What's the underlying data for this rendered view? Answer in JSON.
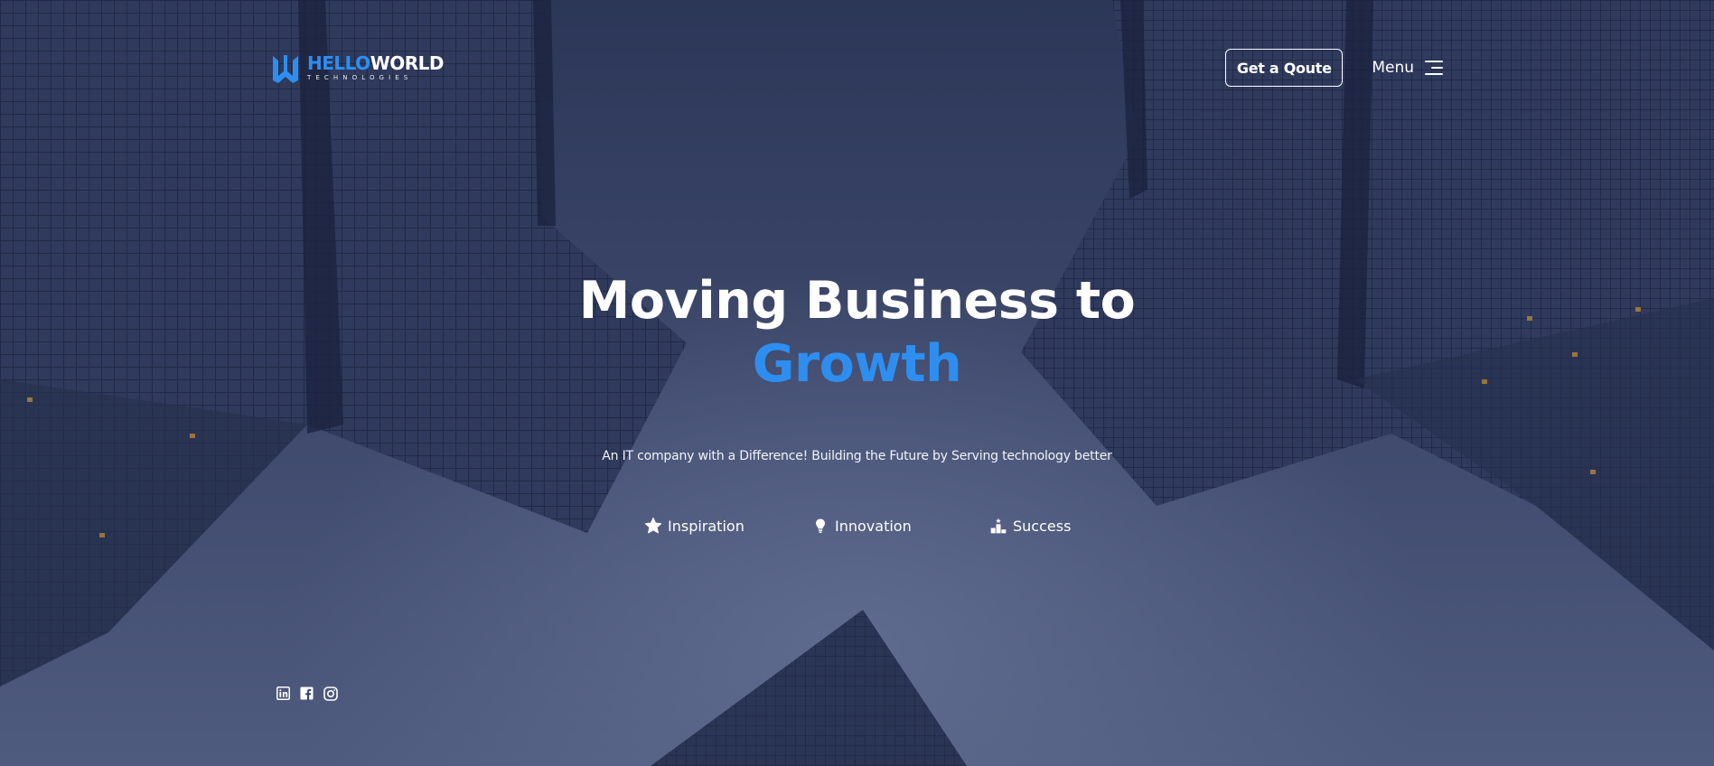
{
  "brand": {
    "logo_part1": "HELLO",
    "logo_part2": "WORLD",
    "tagline": "TECHNOLOGIES",
    "accent_color": "#2e8ef0"
  },
  "header": {
    "quote_button": "Get a Qoute",
    "menu_label": "Menu",
    "menu_icon": "hamburger-icon"
  },
  "hero": {
    "title_line1": "Moving Business to",
    "title_line2": "Growth",
    "subtitle": "An IT company with a Difference! Building the Future by Serving technology better"
  },
  "features": [
    {
      "icon": "star-icon",
      "label": "Inspiration"
    },
    {
      "icon": "lightbulb-icon",
      "label": "Innovation"
    },
    {
      "icon": "podium-icon",
      "label": "Success"
    }
  ],
  "social": [
    {
      "icon": "linkedin-icon"
    },
    {
      "icon": "facebook-icon"
    },
    {
      "icon": "instagram-icon"
    }
  ]
}
